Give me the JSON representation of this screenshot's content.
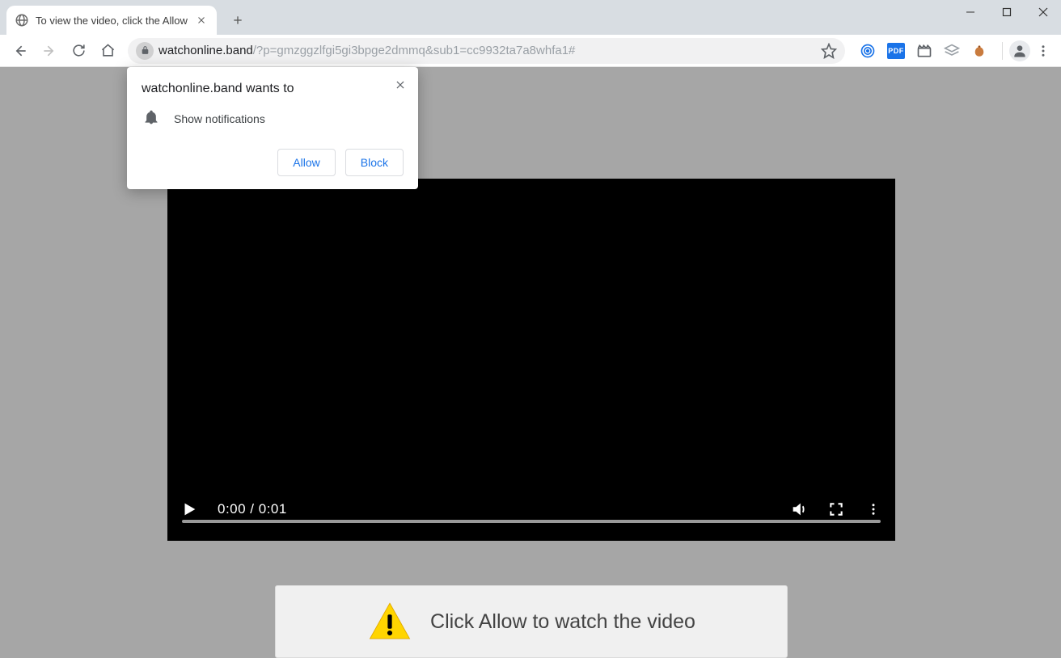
{
  "tab": {
    "title": "To view the video, click the Allow"
  },
  "url": {
    "host": "watchonline.band",
    "path": "/?p=gmzggzlfgi5gi3bpge2dmmq&sub1=cc9932ta7a8whfa1#"
  },
  "extensions": {
    "pdf_label": "PDF"
  },
  "permission": {
    "title": "watchonline.band wants to",
    "request": "Show notifications",
    "allow": "Allow",
    "block": "Block"
  },
  "video": {
    "time": "0:00 / 0:01"
  },
  "banner": {
    "message": "Click Allow to watch the video"
  }
}
